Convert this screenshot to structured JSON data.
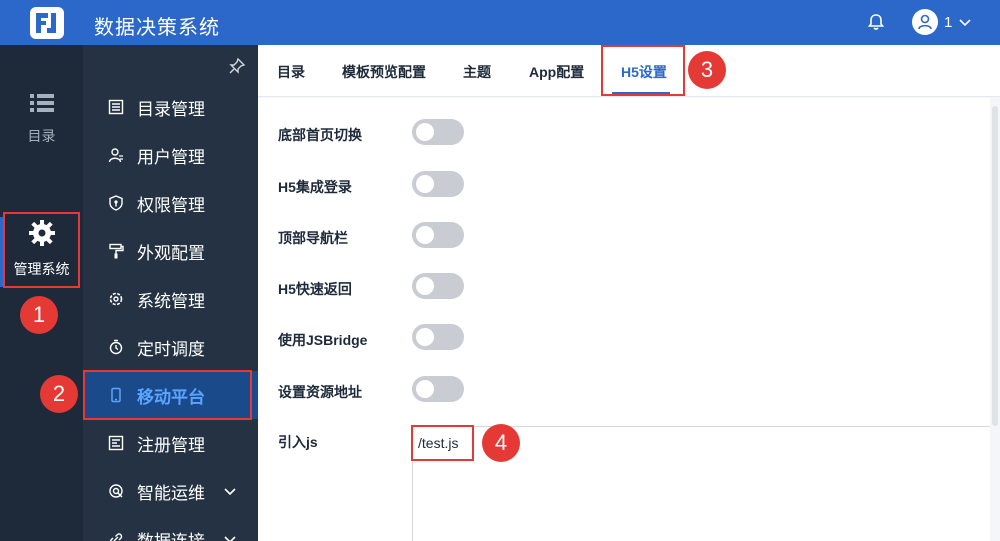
{
  "header": {
    "title": "数据决策系统",
    "user_name": "1",
    "bell_icon": "bell-icon",
    "user_icon": "user-avatar-icon",
    "brand_color": "#2b68c9"
  },
  "rail": {
    "catalog_label": "目录",
    "admin_label": "管理系统"
  },
  "sidebar": {
    "items": [
      {
        "label": "目录管理",
        "icon": "catalog-icon"
      },
      {
        "label": "用户管理",
        "icon": "user-manage-icon"
      },
      {
        "label": "权限管理",
        "icon": "permission-icon"
      },
      {
        "label": "外观配置",
        "icon": "appearance-icon"
      },
      {
        "label": "系统管理",
        "icon": "system-icon"
      },
      {
        "label": "定时调度",
        "icon": "timer-icon"
      },
      {
        "label": "移动平台",
        "icon": "mobile-icon"
      },
      {
        "label": "注册管理",
        "icon": "register-icon"
      },
      {
        "label": "智能运维",
        "icon": "ops-icon"
      },
      {
        "label": "数据连接",
        "icon": "data-link-icon"
      }
    ]
  },
  "tabs": [
    {
      "label": "目录"
    },
    {
      "label": "模板预览配置"
    },
    {
      "label": "主题"
    },
    {
      "label": "App配置"
    },
    {
      "label": "H5设置"
    }
  ],
  "settings": {
    "rows": [
      {
        "label": "底部首页切换",
        "enabled": false
      },
      {
        "label": "H5集成登录",
        "enabled": false
      },
      {
        "label": "顶部导航栏",
        "enabled": false
      },
      {
        "label": "H5快速返回",
        "enabled": false
      },
      {
        "label": "使用JSBridge",
        "enabled": false
      },
      {
        "label": "设置资源地址",
        "enabled": false
      }
    ],
    "js_label": "引入js",
    "js_value": "/test.js"
  },
  "annotations": [
    "1",
    "2",
    "3",
    "4"
  ]
}
